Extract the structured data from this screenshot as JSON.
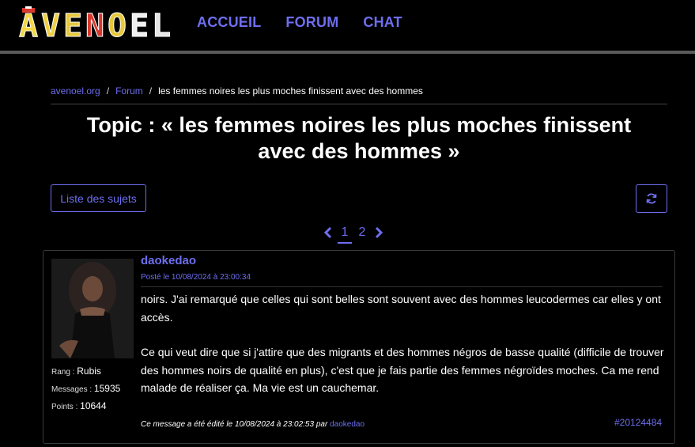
{
  "header": {
    "logo_text": "AVENOEL",
    "nav": [
      {
        "label": "ACCUEIL"
      },
      {
        "label": "FORUM"
      },
      {
        "label": "CHAT"
      }
    ]
  },
  "breadcrumb": {
    "items": [
      "avenoel.org",
      "Forum",
      "les femmes noires les plus moches finissent avec des hommes"
    ],
    "separator": "/"
  },
  "topic": {
    "title_line1": "Topic : « les femmes noires les plus moches finissent",
    "title_line2": "avec des hommes »"
  },
  "toolbar": {
    "list_button": "Liste des sujets",
    "refresh_icon": "refresh-icon"
  },
  "pagination": {
    "pages": [
      "1",
      "2"
    ],
    "current": "1"
  },
  "post": {
    "author": "daokedao",
    "posted": "Posté le 10/08/2024 à 23:00:34",
    "paragraphs": [
      "noirs. J'ai remarqué que celles qui sont belles sont souvent avec des hommes leucodermes car elles y ont accès.",
      "Ce qui veut dire que si j'attire que des migrants et des hommes négros de basse qualité (difficile de trouver des hommes noirs de qualité en plus), c'est que je fais partie des femmes négroïdes moches. Ca me rend malade de réaliser ça. Ma vie est un cauchemar."
    ],
    "stats": {
      "rank_label": "Rang",
      "rank_value": "Rubis",
      "messages_label": "Messages",
      "messages_value": "15935",
      "points_label": "Points",
      "points_value": "10644"
    },
    "edited_prefix": "Ce message a été édité le 10/08/2024 à 23:02:53 par",
    "edited_by": "daokedao",
    "id": "#20124484"
  },
  "colors": {
    "accent": "#6e6ef0",
    "background": "#000000"
  }
}
